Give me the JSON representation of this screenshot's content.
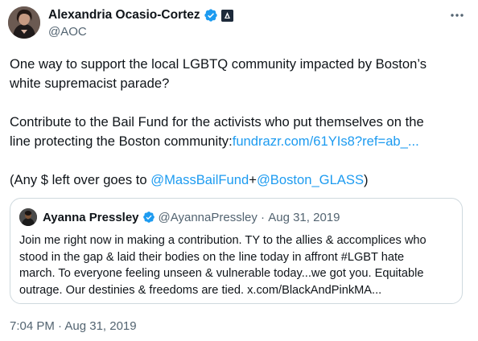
{
  "author": {
    "name": "Alexandria Ocasio-Cortez",
    "handle": "@AOC"
  },
  "tweet": {
    "line1": "One way to support the local LGBTQ community impacted by Boston’s",
    "line2": "white supremacist parade?",
    "line3": "Contribute to the Bail Fund for the activists who put themselves on the",
    "line4_text": "line protecting the Boston community:",
    "line4_link": "fundrazr.com/61YIs8?ref=ab_...",
    "line5_prefix": "(Any $ left over goes to ",
    "mention1": "@MassBailFund",
    "plus": "+",
    "mention2": "@Boston_GLASS",
    "line5_suffix": ")"
  },
  "quoted": {
    "name": "Ayanna Pressley",
    "handle": "@AyannaPressley",
    "separator": " · ",
    "date": "Aug 31, 2019",
    "lines": [
      "Join me right now in making a contribution. TY to the allies & accomplices who",
      "stood in the gap & laid their bodies on the line today in affront #LGBT hate",
      "march. To everyone feeling unseen & vulnerable today...we got you. Equitable",
      "outrage. Our destinies & freedoms are tied. x.com/BlackAndPinkMA..."
    ]
  },
  "timestamp": "7:04 PM · Aug 31, 2019",
  "colors": {
    "link": "#1d9bf0",
    "secondary_text": "#536471",
    "border": "#cfd9de",
    "verified": "#1d9bf0"
  },
  "icons": {
    "verified": "verified-badge-icon",
    "affiliate": "government-affiliate-icon",
    "more": "more-options-icon"
  }
}
